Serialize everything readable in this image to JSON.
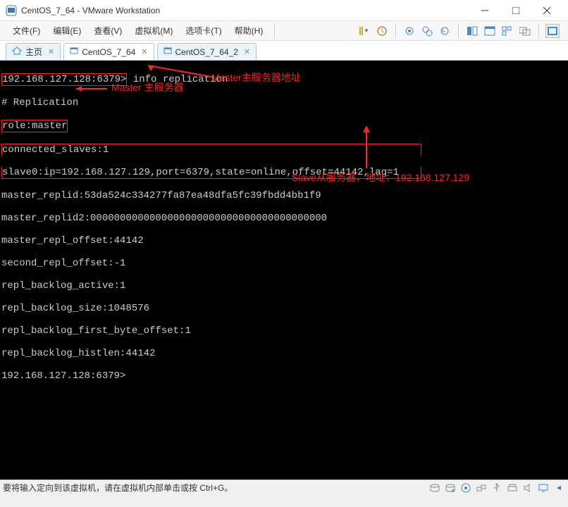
{
  "window": {
    "title": "CentOS_7_64 - VMware Workstation"
  },
  "menu": {
    "file": "文件(F)",
    "edit": "编辑(E)",
    "view": "查看(V)",
    "vm": "虚拟机(M)",
    "tabs": "选项卡(T)",
    "help": "帮助(H)"
  },
  "tabs": {
    "home": "主页",
    "t1": "CentOS_7_64",
    "t2": "CentOS_7_64_2"
  },
  "terminal": {
    "prompt1": "192.168.127.128:6379>",
    "cmd": " info replication",
    "l2": "# Replication",
    "l3": "role:master",
    "l4": "connected_slaves:1",
    "l5": "slave0:ip=192.168.127.129,port=6379,state=online,offset=44142,lag=1",
    "l6": "master_replid:53da524c334277fa87ea48dfa5fc39fbdd4bb1f9",
    "l7": "master_replid2:0000000000000000000000000000000000000000",
    "l8": "master_repl_offset:44142",
    "l9": "second_repl_offset:-1",
    "l10": "repl_backlog_active:1",
    "l11": "repl_backlog_size:1048576",
    "l12": "repl_backlog_first_byte_offset:1",
    "l13": "repl_backlog_histlen:44142",
    "prompt2": "192.168.127.128:6379>"
  },
  "annotations": {
    "a1": "Master主服务器地址",
    "a2": "Master 主服务器",
    "a3": "Slave从服务器，地址：192.168.127.129"
  },
  "status": {
    "hint": "要将输入定向到该虚拟机，请在虚拟机内部单击或按 Ctrl+G。"
  }
}
